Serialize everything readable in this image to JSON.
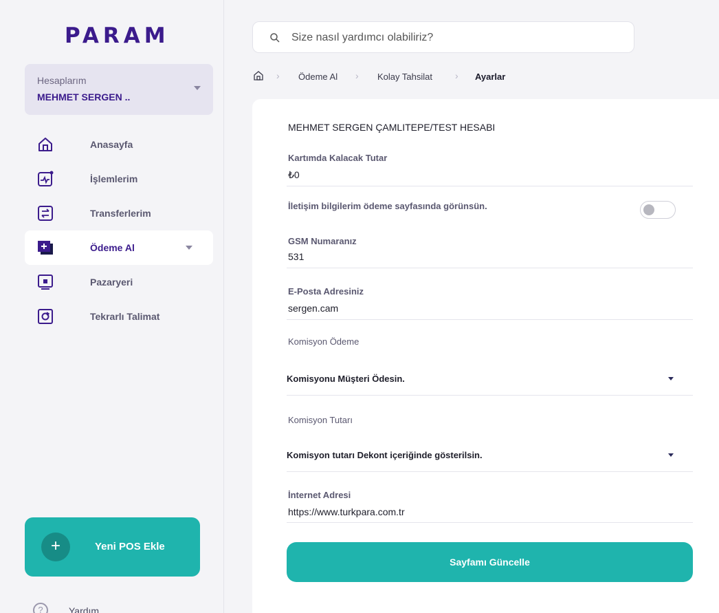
{
  "app": {
    "logo": "PARAM"
  },
  "search": {
    "placeholder": "Size nasıl yardımcı olabiliriz?"
  },
  "account": {
    "label": "Hesaplarım",
    "name": "MEHMET SERGEN .."
  },
  "sidebar": {
    "items": [
      {
        "label": "Anasayfa",
        "icon": "home-icon"
      },
      {
        "label": "İşlemlerim",
        "icon": "activity-icon"
      },
      {
        "label": "Transferlerim",
        "icon": "transfer-icon"
      },
      {
        "label": "Ödeme Al",
        "icon": "payment-add-icon",
        "active": true
      },
      {
        "label": "Pazaryeri",
        "icon": "marketplace-icon"
      },
      {
        "label": "Tekrarlı Talimat",
        "icon": "recurring-icon"
      }
    ],
    "new_pos": "Yeni POS Ekle",
    "help": "Yardım"
  },
  "breadcrumb": [
    "Ödeme Al",
    "Kolay Tahsilat",
    "Ayarlar"
  ],
  "form": {
    "top_value": "MEHMET SERGEN ÇAMLITEPE/TEST HESABI",
    "card_amount": {
      "label": "Kartımda Kalacak Tutar",
      "value": "₺0"
    },
    "contact_toggle": {
      "label": "İletişim bilgilerim ödeme sayfasında görünsün.",
      "on": false
    },
    "gsm": {
      "label": "GSM Numaranız",
      "value": "531"
    },
    "email": {
      "label": "E-Posta Adresiniz",
      "value": "sergen.cam"
    },
    "commission_payment": {
      "label": "Komisyon Ödeme",
      "value": "Komisyonu Müşteri Ödesin."
    },
    "commission_amount": {
      "label": "Komisyon Tutarı",
      "value": "Komisyon tutarı Dekont içeriğinde gösterilsin."
    },
    "website": {
      "label": "İnternet Adresi",
      "value": "https://www.turkpara.com.tr"
    },
    "submit": "Sayfamı Güncelle"
  },
  "colors": {
    "brand": "#3b1b8c",
    "accent": "#1fb4ad"
  }
}
